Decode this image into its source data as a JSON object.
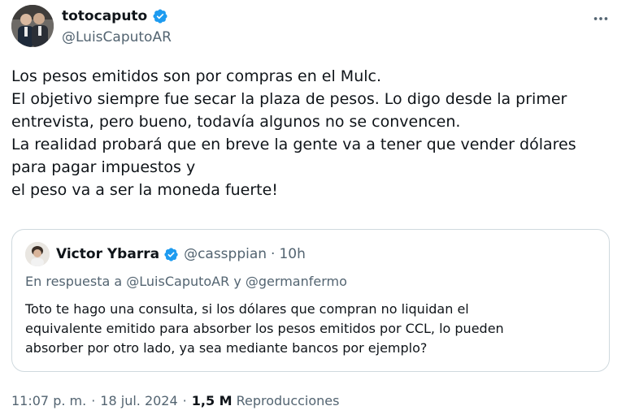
{
  "tweet": {
    "display_name": "totocaputo",
    "handle": "@LuisCaputoAR",
    "text_lines": [
      "Los pesos emitidos son por compras en el Mulc.",
      "El objetivo siempre fue secar la plaza de pesos. Lo digo desde la primer",
      "entrevista, pero bueno, todavía algunos no se convencen.",
      "La realidad probará que en breve la gente va a tener que vender dólares",
      "para pagar impuestos y",
      "el peso va a ser la moneda fuerte!"
    ],
    "time": "11:07 p. m.",
    "date": "18 jul. 2024",
    "views_count": "1,5 M",
    "views_label": "Reproducciones",
    "separator": "·"
  },
  "quote": {
    "display_name": "Victor Ybarra",
    "handle": "@cassppian",
    "separator": "·",
    "time": "10h",
    "reply_prefix": "En respuesta a",
    "reply_mention_1": "@LuisCaputoAR",
    "reply_and": "y",
    "reply_mention_2": "@germanfermo",
    "text_lines": [
      "Toto te hago una consulta, si los dólares que compran no liquidan el",
      "equivalente emitido para absorber los pesos emitidos por CCL, lo pueden",
      "absorber por otro lado, ya sea mediante bancos por ejemplo?"
    ]
  },
  "colors": {
    "verified": "#1d9bf0",
    "secondary_text": "#536471",
    "border": "#cfd9de"
  },
  "icons": {
    "verified": "verified-badge-icon",
    "more": "more-options-icon"
  }
}
